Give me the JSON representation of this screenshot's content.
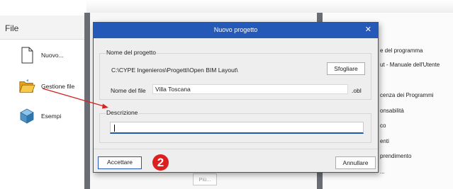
{
  "background": {
    "file_panel": {
      "title": "File",
      "items": [
        {
          "label": "Nuovo...",
          "icon": "new-document-icon"
        },
        {
          "label": "Gestione file",
          "icon": "folder-icon"
        },
        {
          "label": "Esempi",
          "icon": "examples-cube-icon"
        }
      ]
    },
    "middle_panel": {
      "button_label": "Più..."
    },
    "right_panel": {
      "links": [
        "e del programma",
        "ut - Manuale dell'Utente",
        "cenza dei Programmi",
        "onsabilità",
        "co",
        "enti",
        "prendimento",
        "..."
      ]
    }
  },
  "dialog": {
    "title": "Nuovo progetto",
    "close_icon": "close-icon",
    "project_name_group": {
      "label": "Nome del progetto",
      "path": "C:\\CYPE Ingenieros\\Progetti\\Open BIM Layout\\",
      "browse_label": "Sfogliare",
      "file_name_label": "Nome del file",
      "file_name_value": "Villa Toscana",
      "extension": ".obl"
    },
    "description_group": {
      "label": "Descrizione",
      "value": ""
    },
    "accept_label": "Accettare",
    "cancel_label": "Annullare"
  },
  "annotation": {
    "step_number": "2",
    "color": "#dc1f1f"
  }
}
